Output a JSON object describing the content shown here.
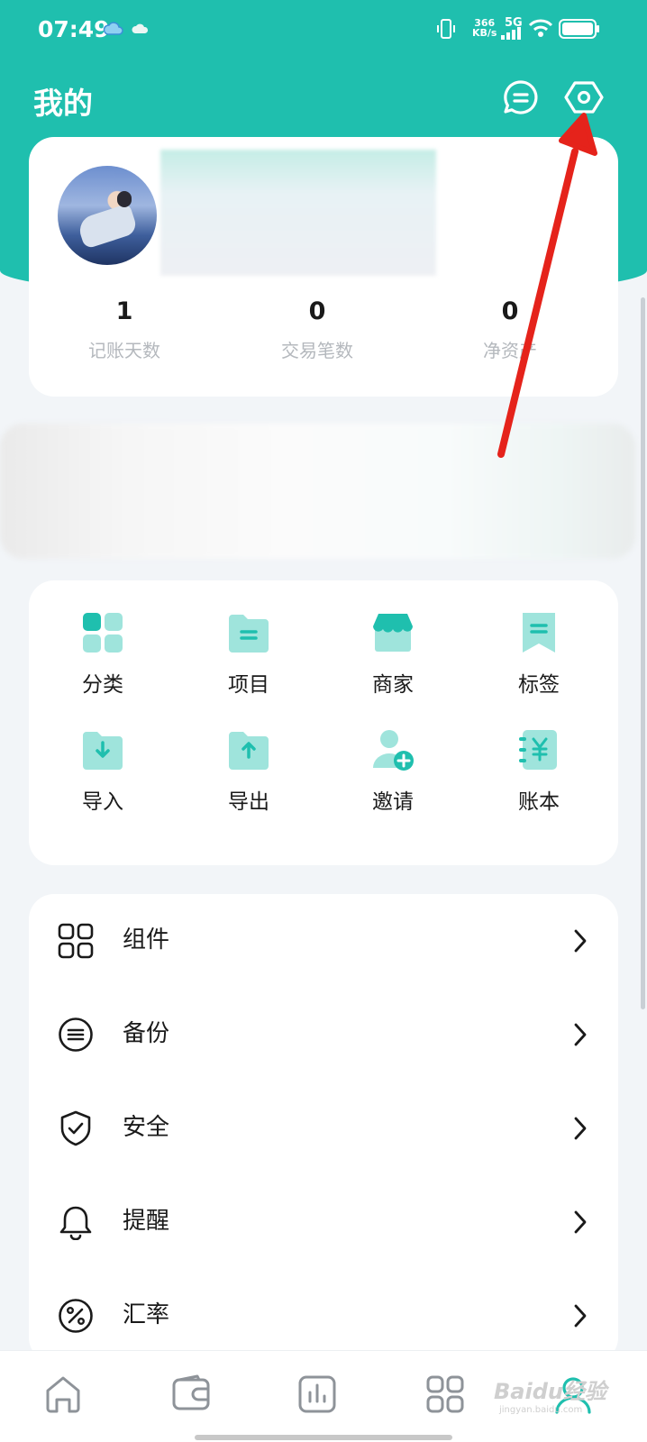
{
  "status_bar": {
    "time": "07:49",
    "net_speed_value": "366",
    "net_speed_unit": "KB/s",
    "network": "5G"
  },
  "header": {
    "title": "我的",
    "icons": [
      "message-icon",
      "settings-icon"
    ]
  },
  "profile": {
    "stats": [
      {
        "value": "1",
        "label": "记账天数"
      },
      {
        "value": "0",
        "label": "交易笔数"
      },
      {
        "value": "0",
        "label": "净资产"
      }
    ]
  },
  "shortcuts": [
    {
      "label": "分类",
      "icon": "category-icon"
    },
    {
      "label": "项目",
      "icon": "project-folder-icon"
    },
    {
      "label": "商家",
      "icon": "store-icon"
    },
    {
      "label": "标签",
      "icon": "tag-icon"
    },
    {
      "label": "导入",
      "icon": "import-icon"
    },
    {
      "label": "导出",
      "icon": "export-icon"
    },
    {
      "label": "邀请",
      "icon": "invite-user-icon"
    },
    {
      "label": "账本",
      "icon": "ledger-yen-icon"
    }
  ],
  "menu": [
    {
      "label": "组件",
      "icon": "widgets-grid-icon"
    },
    {
      "label": "备份",
      "icon": "backup-icon"
    },
    {
      "label": "安全",
      "icon": "shield-check-icon"
    },
    {
      "label": "提醒",
      "icon": "bell-icon"
    },
    {
      "label": "汇率",
      "icon": "percent-icon"
    }
  ],
  "tabbar": {
    "tabs": [
      "home-icon",
      "wallet-icon",
      "stats-icon",
      "apps-grid-icon",
      "profile-icon"
    ],
    "active_index": 4
  },
  "watermark": {
    "brand": "Baidu经验",
    "url": "jingyan.baidu.com"
  },
  "colors": {
    "accent": "#1fbfae",
    "accent_light": "#9fe4dc",
    "arrow": "#e5231b"
  }
}
